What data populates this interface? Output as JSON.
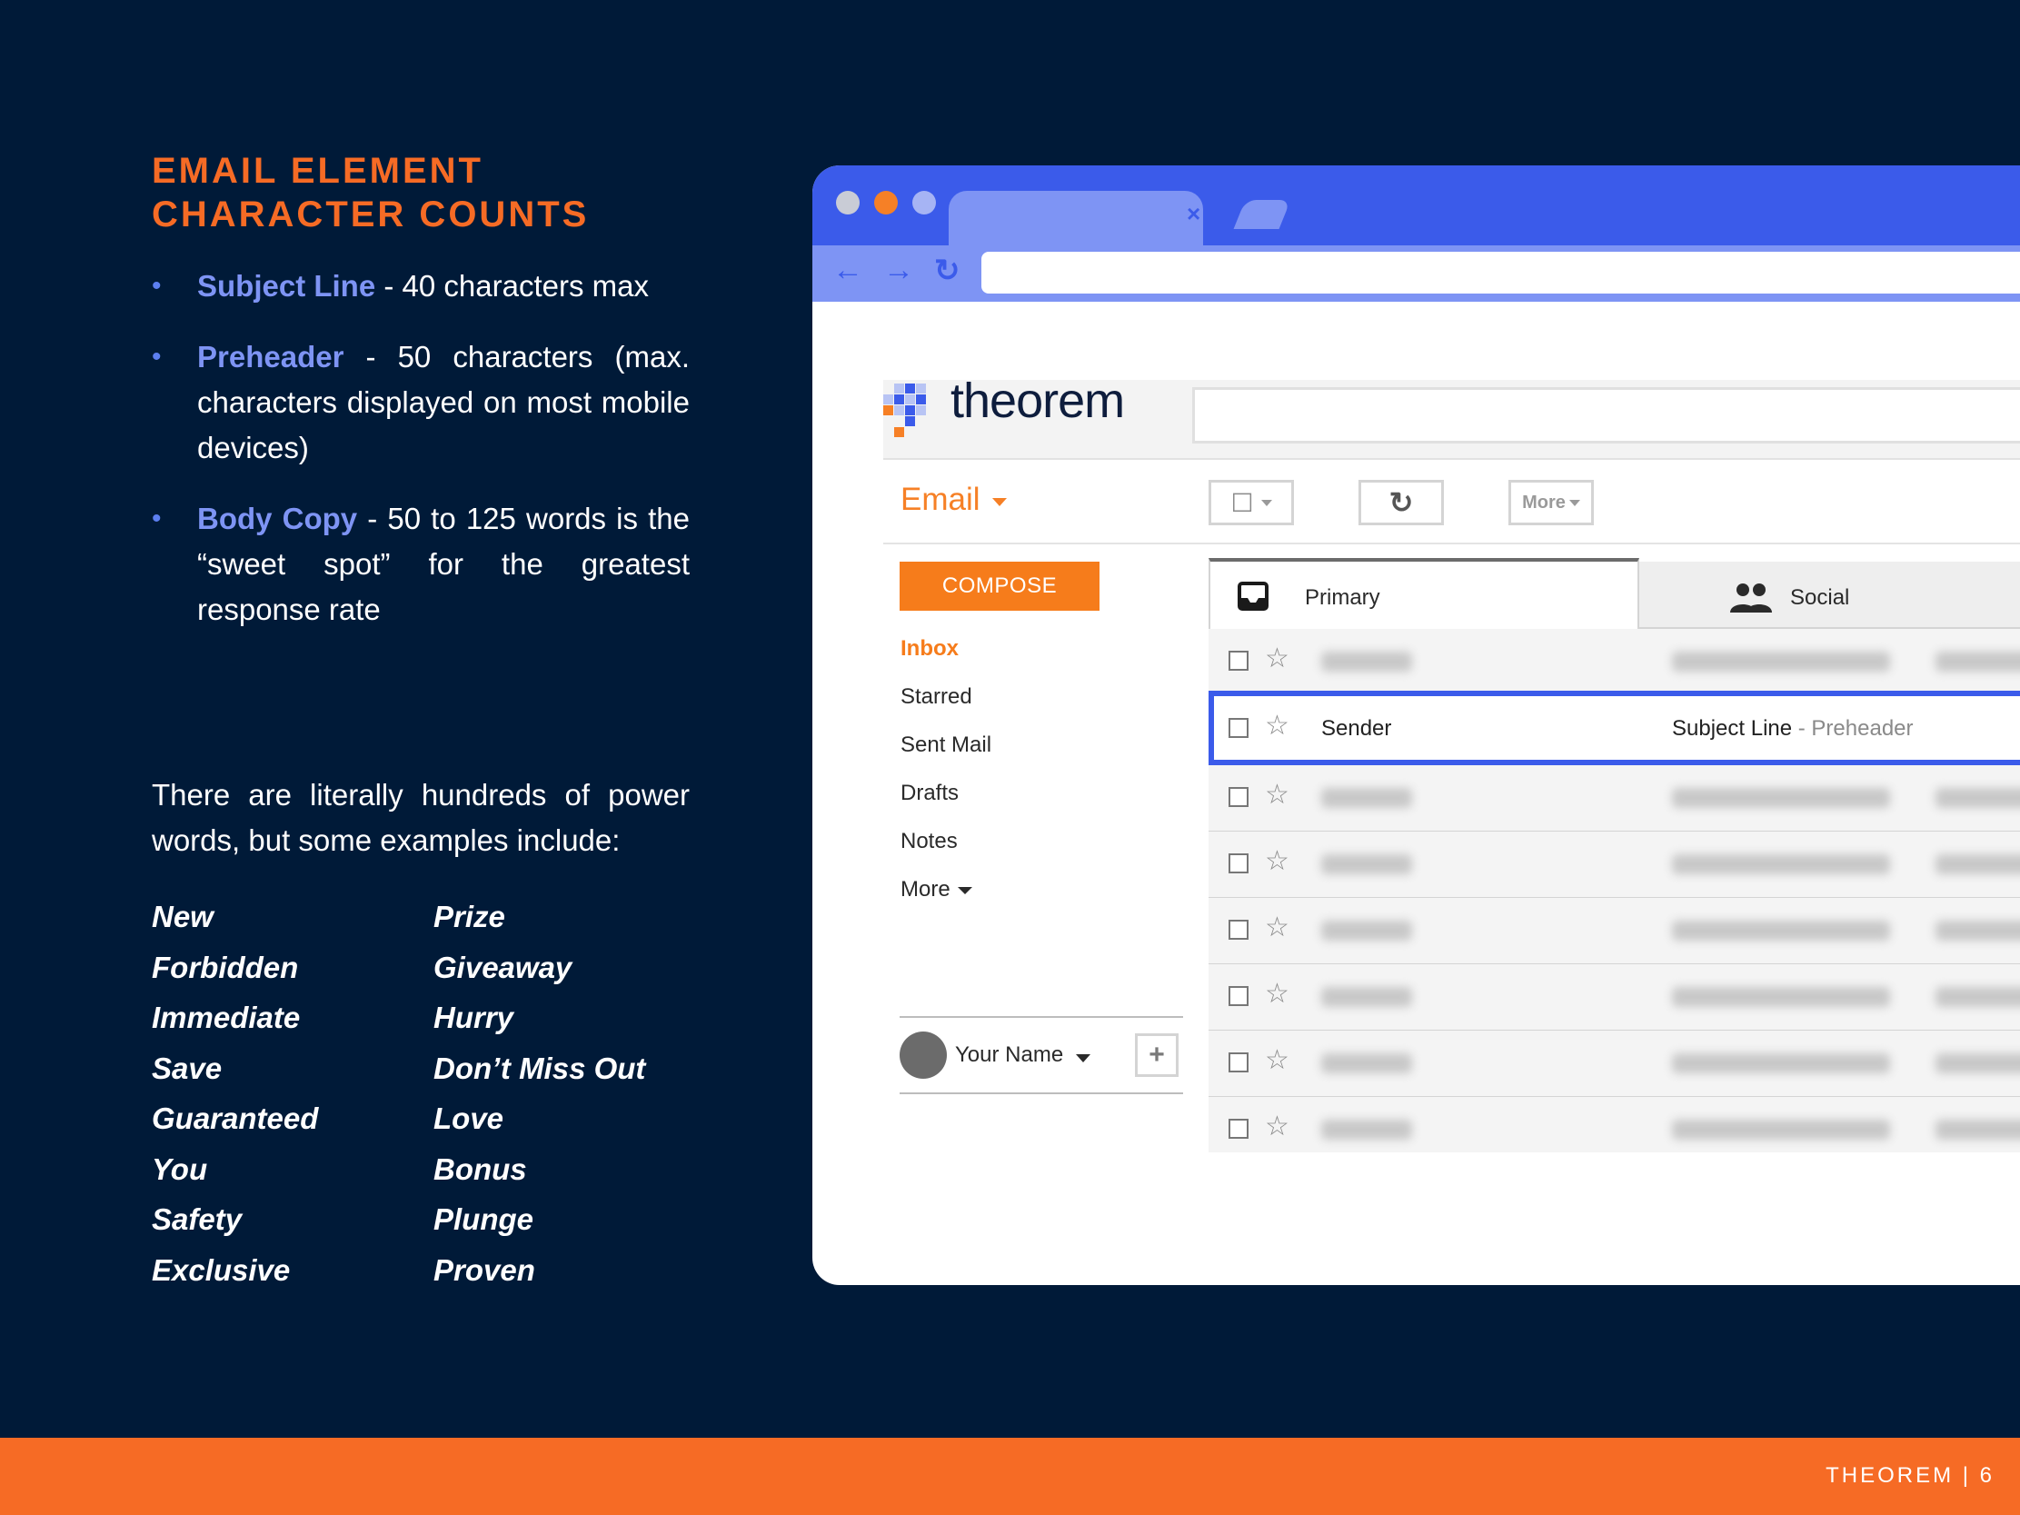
{
  "slide": {
    "title_line1": "EMAIL ELEMENT",
    "title_line2": "CHARACTER COUNTS",
    "bullets": [
      {
        "term": "Subject Line",
        "text": " -  40 characters max"
      },
      {
        "term": "Preheader",
        "text": " - 50 characters (max. characters displayed on most mobile devices)"
      },
      {
        "term": "Body Copy",
        "text": " - 50 to 125 words is the “sweet spot” for the greatest response rate"
      }
    ],
    "bullet_symbol": "•",
    "intro": "There are literally hundreds of power words, but some examples include:",
    "words_col1": [
      "New",
      "Forbidden",
      "Immediate",
      "Save",
      "Guaranteed",
      "You",
      "Safety",
      "Exclusive"
    ],
    "words_col2": [
      "Prize",
      "Giveaway",
      "Hurry",
      "Don’t Miss Out",
      "Love",
      "Bonus",
      "Plunge",
      "Proven"
    ],
    "footer": "THEOREM | 6"
  },
  "browser": {
    "tab_close": "×",
    "nav": {
      "back": "←",
      "forward": "→",
      "reload": "↻"
    },
    "logo": "theorem",
    "mail_label": "Email",
    "toolbar": {
      "select": "☐",
      "refresh": "↻",
      "more": "More"
    },
    "compose": "COMPOSE",
    "sidebar": [
      {
        "label": "Inbox",
        "active": true
      },
      {
        "label": "Starred"
      },
      {
        "label": "Sent Mail"
      },
      {
        "label": "Drafts"
      },
      {
        "label": "Notes"
      },
      {
        "label": "More"
      }
    ],
    "account": {
      "name": "Your Name",
      "add": "+"
    },
    "tabs": [
      {
        "label": "Primary",
        "icon": "inbox-icon"
      },
      {
        "label": "Social",
        "icon": "people-icon"
      }
    ],
    "highlighted_row": {
      "sender": "Sender",
      "subject": "Subject Line",
      "preheader": " - Preheader"
    },
    "star": "☆"
  },
  "colors": {
    "background": "#001a38",
    "accent_orange": "#f66b25",
    "term_blue": "#7e94f4",
    "browser_blue": "#3b5bea"
  }
}
